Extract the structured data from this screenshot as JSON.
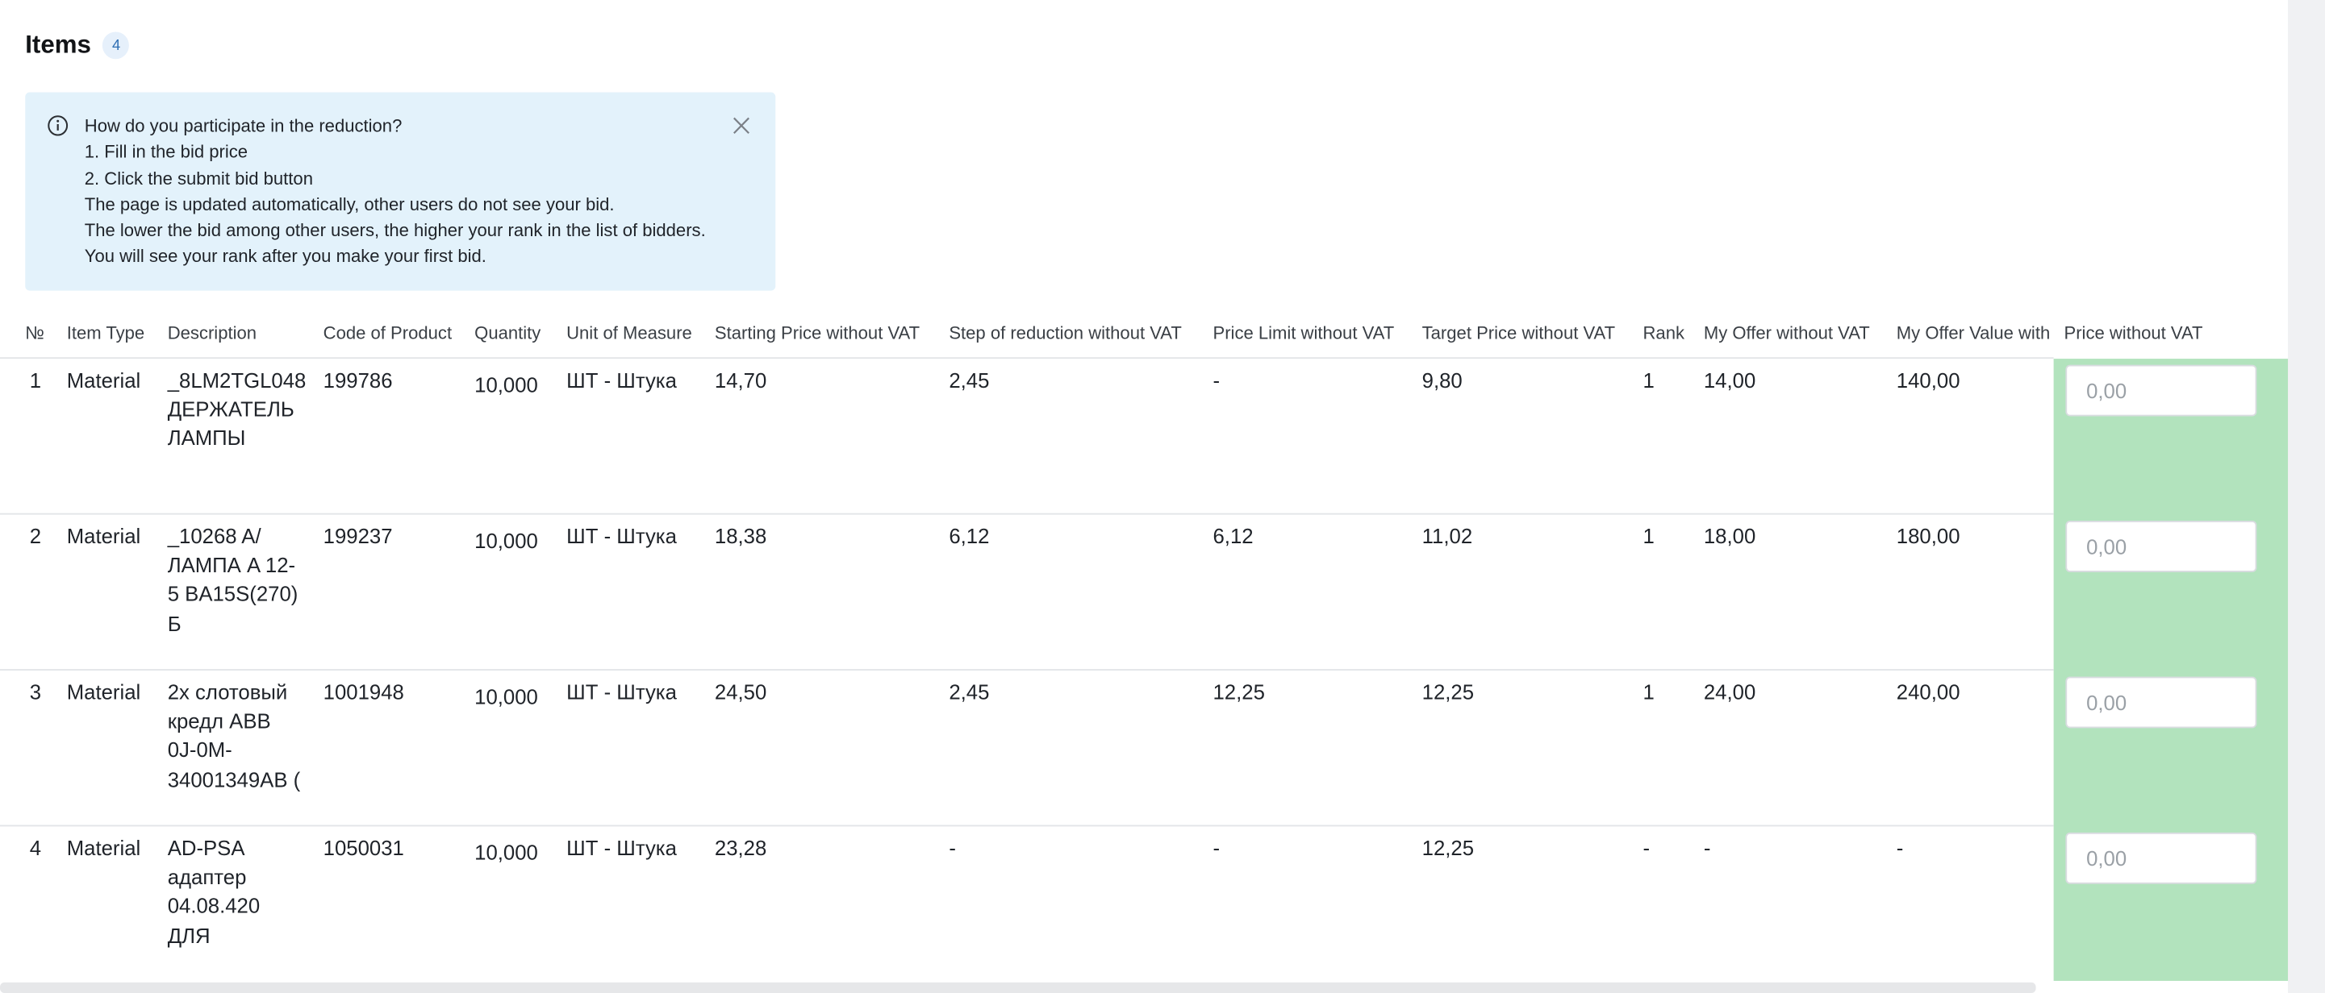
{
  "header": {
    "title": "Items",
    "count": "4"
  },
  "info": {
    "icon": "info-icon",
    "lines": [
      "How do you participate in the reduction?",
      "1. Fill in the bid price",
      "2. Click the submit bid button",
      "The page is updated automatically, other users do not see your bid.",
      "The lower the bid among other users, the higher your rank in the list of bidders.",
      "You will see your rank after you make your first bid."
    ],
    "close_icon": "close-icon"
  },
  "table": {
    "columns": [
      "№",
      "Item Type",
      "Description",
      "Code of Product",
      "Quantity",
      "Unit of Measure",
      "Starting Price without VAT",
      "Step of reduction without VAT",
      "Price Limit without VAT",
      "Target Price without VAT",
      "Rank",
      "My Offer without VAT",
      "My Offer Value with",
      "Price without VAT"
    ],
    "rows": [
      {
        "no": "1",
        "type": "Material",
        "desc_lines": [
          "_8LM2TGL048",
          "ДЕРЖАТЕЛЬ",
          "ЛАМПЫ"
        ],
        "code": "199786",
        "qty": "10,000",
        "uom": "ШТ - Штука",
        "start": "14,70",
        "step": "2,45",
        "limit": "-",
        "target": "9,80",
        "rank": "1",
        "offer": "14,00",
        "offer_value": "140,00",
        "bid_placeholder": "0,00"
      },
      {
        "no": "2",
        "type": "Material",
        "desc_lines": [
          "_10268 A/",
          "ЛАМПА A 12-",
          "5 BA15S(270)",
          "Б"
        ],
        "code": "199237",
        "qty": "10,000",
        "uom": "ШТ - Штука",
        "start": "18,38",
        "step": "6,12",
        "limit": "6,12",
        "target": "11,02",
        "rank": "1",
        "offer": "18,00",
        "offer_value": "180,00",
        "bid_placeholder": "0,00"
      },
      {
        "no": "3",
        "type": "Material",
        "desc_lines": [
          "2х слотовый",
          "кредл ABB",
          "0J-0M-",
          "34001349AB ("
        ],
        "code": "1001948",
        "qty": "10,000",
        "uom": "ШТ - Штука",
        "start": "24,50",
        "step": "2,45",
        "limit": "12,25",
        "target": "12,25",
        "rank": "1",
        "offer": "24,00",
        "offer_value": "240,00",
        "bid_placeholder": "0,00"
      },
      {
        "no": "4",
        "type": "Material",
        "desc_lines": [
          "AD-PSA",
          "адаптер",
          "04.08.420",
          "ДЛЯ"
        ],
        "code": "1050031",
        "qty": "10,000",
        "uom": "ШТ - Штука",
        "start": "23,28",
        "step": "-",
        "limit": "-",
        "target": "12,25",
        "rank": "-",
        "offer": "-",
        "offer_value": "-",
        "bid_placeholder": "0,00"
      }
    ]
  },
  "colors": {
    "info_bg": "#e3f2fb",
    "bid_column_bg": "#b2e3bd",
    "badge_bg": "#e6f0fb",
    "badge_text": "#2f6fb3"
  }
}
